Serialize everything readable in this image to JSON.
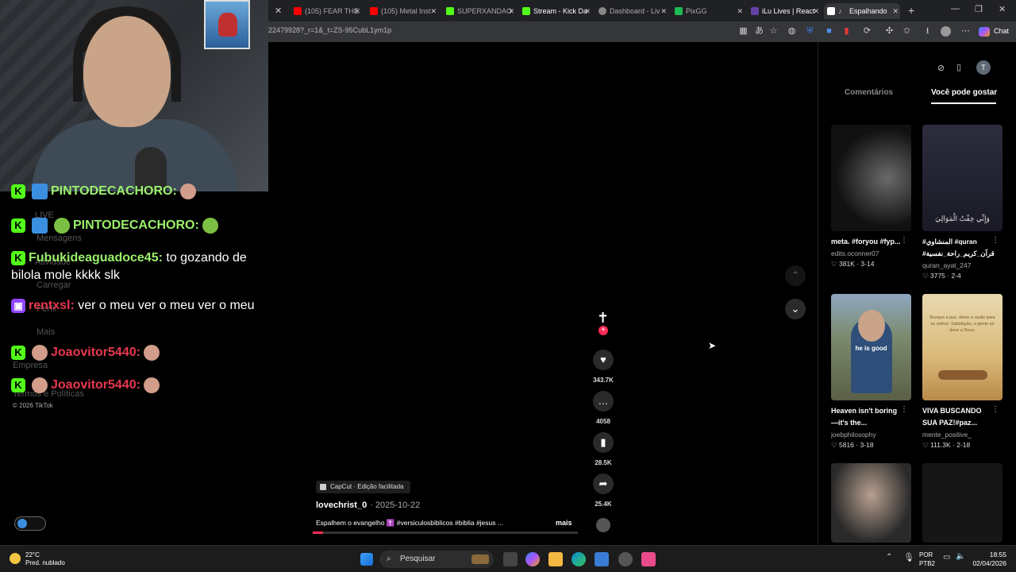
{
  "browser": {
    "tabs": [
      {
        "label": "(105) FEAR THE",
        "color": "#ff0000"
      },
      {
        "label": "(105) Metal Inst",
        "color": "#ff0000"
      },
      {
        "label": "SUPERXANDAO",
        "color": "#53fc18"
      },
      {
        "label": "Stream - Kick Da",
        "color": "#53fc18"
      },
      {
        "label": "Dashboard - Liv",
        "color": "#888888"
      },
      {
        "label": "PixGG",
        "color": "#1db954"
      },
      {
        "label": "iLu Lives | React",
        "color": "#6441a5"
      },
      {
        "label": "Espalhando",
        "color": "#ffffff"
      }
    ],
    "url": "22479928?_r=1&_t=ZS-95CubL1ym1p",
    "chat_button_label": "Chat"
  },
  "chat": {
    "messages": [
      {
        "user": "PINTODECACHORO:",
        "text": "",
        "platform": "kick"
      },
      {
        "user": "PINTODECACHORO:",
        "text": "",
        "platform": "kick"
      },
      {
        "user": "Fubukideaguadoce45:",
        "text": "to gozando de bilola mole kkkk slk",
        "platform": "kick"
      },
      {
        "user": "rentxsl:",
        "text": "ver o meu ver o meu ver o meu",
        "platform": "twitch"
      },
      {
        "user": "Joaovitor5440:",
        "text": "",
        "platform": "kick"
      },
      {
        "user": "Joaovitor5440:",
        "text": "",
        "platform": "kick"
      }
    ],
    "ghost_nav": [
      "LIVE",
      "Mensagens",
      "Atividade",
      "Carregar",
      "Perfil",
      "Mais",
      "Empresa",
      "Termos e Políticas"
    ],
    "copyright": "© 2026 TikTok",
    "platform_icons": {
      "kick": "K",
      "twitch": "tv-icon"
    }
  },
  "video": {
    "like_count": "343.7K",
    "comment_count": "4058",
    "bookmark_count": "28.5K",
    "share_count": "25.4K",
    "capcut_label": "CapCut · Edição facilitada",
    "author": "lovechrist_0",
    "date": "· 2025-10-22",
    "description": "Espalhem o evangelho ✝️ #versiculosbiblicos #biblia #jesus ...",
    "more_label": "mais",
    "progress": 0.04
  },
  "right_panel": {
    "tabs": [
      "Comentários",
      "Você pode gostar"
    ],
    "active_tab": 1,
    "cards": [
      {
        "title": "meta. #foryou #fyp...",
        "author": "edits.oconner07",
        "likes": "381K",
        "date": "3-14"
      },
      {
        "title": "#المنشاوي #quran #قرآن_كريم_راحة_نفسية",
        "author": "quran_ayat_247",
        "likes": "3775",
        "date": "2-4",
        "overlay": "وَإِنِّي خِفْتُ الْمَوَالِيَ"
      },
      {
        "title": "Heaven isn't boring—it's the...",
        "author": "joebphilosophy",
        "likes": "5816",
        "date": "3-18",
        "overlay": "he is good"
      },
      {
        "title": "VIVA BUSCANDO SUA PAZ!#paz...",
        "author": "mente_positive_",
        "likes": "111.3K",
        "date": "2-18",
        "overlay": "Busque a paz, deixe a razão para os outros. Satisfação, a gente só deve a Deus."
      }
    ]
  },
  "taskbar": {
    "weather_temp": "22°C",
    "weather_desc": "Pred. nublado",
    "search_placeholder": "Pesquisar",
    "lang_top": "POR",
    "lang_bottom": "PTB2",
    "time": "18:55",
    "date": "02/04/2026"
  }
}
